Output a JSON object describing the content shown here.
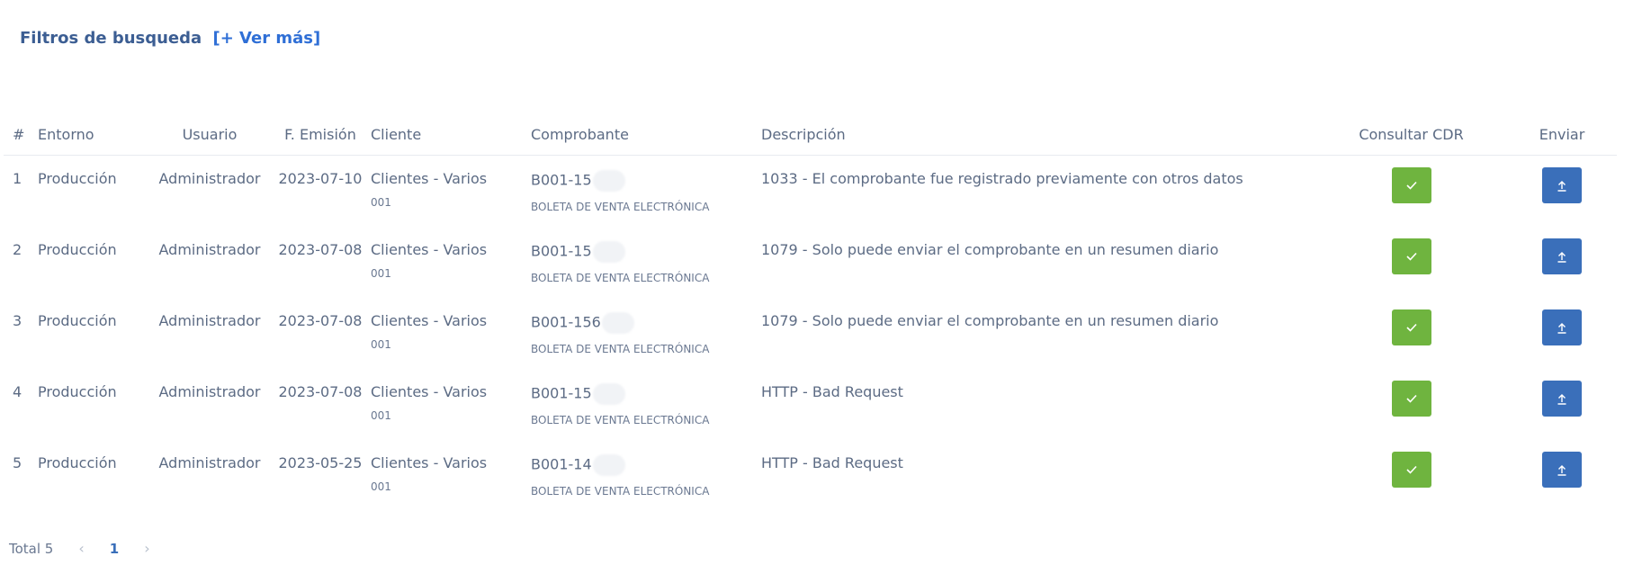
{
  "filters": {
    "label": "Filtros de busqueda",
    "more": "[+ Ver más]"
  },
  "table": {
    "headers": {
      "num": "#",
      "entorno": "Entorno",
      "usuario": "Usuario",
      "emision": "F. Emisión",
      "cliente": "Cliente",
      "comprobante": "Comprobante",
      "descripcion": "Descripción",
      "cdr": "Consultar CDR",
      "enviar": "Enviar"
    },
    "rows": [
      {
        "n": "1",
        "entorno": "Producción",
        "usuario": "Administrador",
        "fecha": "2023-07-10",
        "cliente": "Clientes - Varios",
        "cliente_sub": "001",
        "comprobante": "B001-15",
        "comprobante_sub": "BOLETA DE VENTA ELECTRÓNICA",
        "descripcion": "1033 - El comprobante fue registrado previamente con otros datos"
      },
      {
        "n": "2",
        "entorno": "Producción",
        "usuario": "Administrador",
        "fecha": "2023-07-08",
        "cliente": "Clientes - Varios",
        "cliente_sub": "001",
        "comprobante": "B001-15",
        "comprobante_sub": "BOLETA DE VENTA ELECTRÓNICA",
        "descripcion": "1079 - Solo puede enviar el comprobante en un resumen diario"
      },
      {
        "n": "3",
        "entorno": "Producción",
        "usuario": "Administrador",
        "fecha": "2023-07-08",
        "cliente": "Clientes - Varios",
        "cliente_sub": "001",
        "comprobante": "B001-156",
        "comprobante_sub": "BOLETA DE VENTA ELECTRÓNICA",
        "descripcion": "1079 - Solo puede enviar el comprobante en un resumen diario"
      },
      {
        "n": "4",
        "entorno": "Producción",
        "usuario": "Administrador",
        "fecha": "2023-07-08",
        "cliente": "Clientes - Varios",
        "cliente_sub": "001",
        "comprobante": "B001-15",
        "comprobante_sub": "BOLETA DE VENTA ELECTRÓNICA",
        "descripcion": "HTTP - Bad Request"
      },
      {
        "n": "5",
        "entorno": "Producción",
        "usuario": "Administrador",
        "fecha": "2023-05-25",
        "cliente": "Clientes - Varios",
        "cliente_sub": "001",
        "comprobante": "B001-14",
        "comprobante_sub": "BOLETA DE VENTA ELECTRÓNICA",
        "descripcion": "HTTP - Bad Request"
      }
    ],
    "actions": {
      "cdr_icon": "check-icon",
      "send_icon": "upload-icon",
      "cdr_color": "#6fb43f",
      "send_color": "#3a6fba"
    }
  },
  "pagination": {
    "total_label": "Total 5",
    "prev_icon": "chevron-left-icon",
    "current_page": "1",
    "next_icon": "chevron-right-icon"
  }
}
